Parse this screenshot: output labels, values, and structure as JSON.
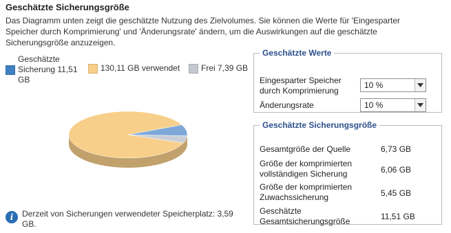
{
  "title": "Geschätzte Sicherungsgröße",
  "description": "Das Diagramm unten zeigt die geschätzte Nutzung des Zielvolumes. Sie können die Werte für 'Eingesparter Speicher durch Komprimierung' und 'Änderungsrate' ändern, um die Auswirkungen auf die geschätzte Sicherungsgröße anzuzeigen.",
  "legend": [
    {
      "label": "Geschätzte Sicherung 11,51 GB",
      "color": "#3f7fc4"
    },
    {
      "label": "130,11 GB verwendet",
      "color": "#f8cf8a"
    },
    {
      "label": "Frei 7,39 GB",
      "color": "#c4c9d1"
    }
  ],
  "chart_data": {
    "type": "pie",
    "unit": "GB",
    "slices": [
      {
        "label": "Geschätzte Sicherung",
        "value": 11.51,
        "color": "#7ea8d8"
      },
      {
        "label": "verwendet",
        "value": 130.11,
        "color": "#f8cf8a"
      },
      {
        "label": "Frei",
        "value": 7.39,
        "color": "#c9ced6"
      }
    ]
  },
  "info": {
    "text": "Derzeit von Sicherungen verwendeter Speicherplatz: 3,59 GB."
  },
  "estimated_values": {
    "legend": "Geschätzte Werte",
    "compression_label": "Eingesparter Speicher durch Komprimierung",
    "compression_value": "10 %",
    "change_rate_label": "Änderungsrate",
    "change_rate_value": "10 %"
  },
  "backup_size": {
    "legend": "Geschätzte Sicherungsgröße",
    "rows": [
      {
        "label": "Gesamtgröße der Quelle",
        "value": "6,73 GB"
      },
      {
        "label": "Größe der komprimierten vollständigen Sicherung",
        "value": "6,06 GB"
      },
      {
        "label": "Größe der komprimierten Zuwachssicherung",
        "value": "5,45 GB"
      },
      {
        "label": "Geschätzte Gesamtsicherungsgröße",
        "value": "11,51 GB"
      }
    ]
  }
}
